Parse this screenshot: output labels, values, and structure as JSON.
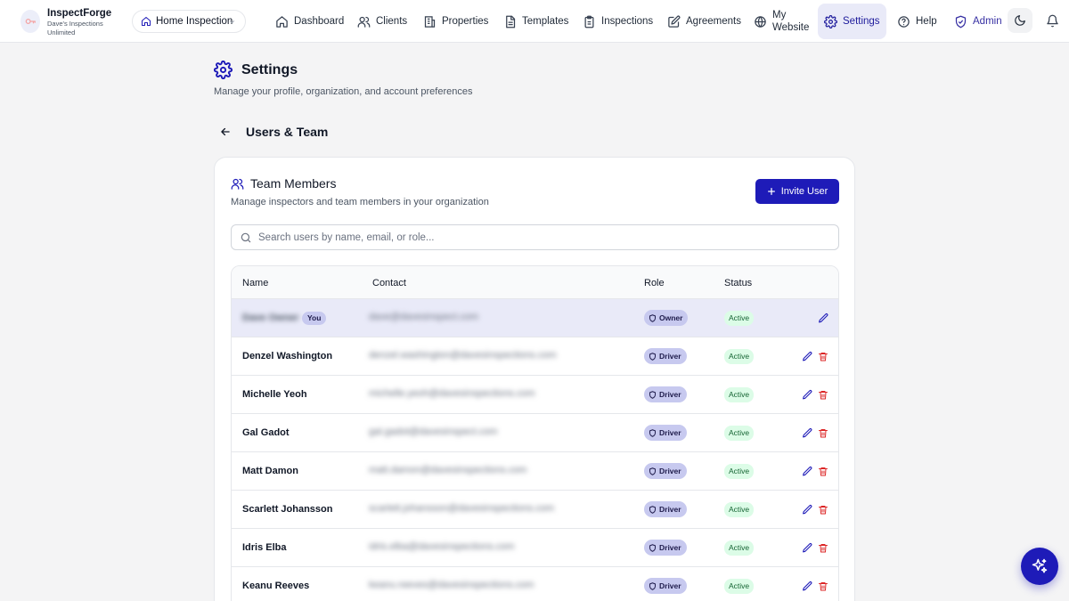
{
  "app": {
    "name": "InspectForge",
    "org": "Dave's Inspections Unlimited",
    "workspace": "Home Inspection"
  },
  "nav": {
    "items": [
      {
        "label": "Dashboard",
        "icon": "home-icon"
      },
      {
        "label": "Clients",
        "icon": "users-icon"
      },
      {
        "label": "Properties",
        "icon": "building-icon"
      },
      {
        "label": "Templates",
        "icon": "file-icon"
      },
      {
        "label": "Inspections",
        "icon": "clipboard-icon"
      },
      {
        "label": "Agreements",
        "icon": "pen-square-icon"
      },
      {
        "label": "My Website",
        "icon": "globe-icon"
      },
      {
        "label": "Settings",
        "icon": "gear-icon",
        "active": true
      },
      {
        "label": "Help",
        "icon": "help-circle-icon"
      },
      {
        "label": "Admin",
        "icon": "shield-check-icon"
      }
    ],
    "my_website_line1": "My",
    "my_website_line2": "Website"
  },
  "page": {
    "title": "Settings",
    "subtitle": "Manage your profile, organization, and account preferences",
    "section": "Users & Team"
  },
  "team": {
    "title": "Team Members",
    "subtitle": "Manage inspectors and team members in your organization",
    "invite_label": "Invite User",
    "search_placeholder": "Search users by name, email, or role...",
    "columns": {
      "name": "Name",
      "contact": "Contact",
      "role": "Role",
      "status": "Status"
    },
    "you_label": "You",
    "members": [
      {
        "name": "Dave Owner",
        "contact": "dave@davesinspect.com",
        "role": "Owner",
        "status": "Active",
        "is_you": true
      },
      {
        "name": "Denzel Washington",
        "contact": "denzel.washington@davesinspections.com",
        "role": "Driver",
        "status": "Active"
      },
      {
        "name": "Michelle Yeoh",
        "contact": "michelle.yeoh@davesinspections.com",
        "role": "Driver",
        "status": "Active"
      },
      {
        "name": "Gal Gadot",
        "contact": "gal.gadot@davesinspect.com",
        "role": "Driver",
        "status": "Active"
      },
      {
        "name": "Matt Damon",
        "contact": "matt.damon@davesinspections.com",
        "role": "Driver",
        "status": "Active"
      },
      {
        "name": "Scarlett Johansson",
        "contact": "scarlett.johansson@davesinspections.com",
        "role": "Driver",
        "status": "Active"
      },
      {
        "name": "Idris Elba",
        "contact": "idris.elba@davesinspections.com",
        "role": "Driver",
        "status": "Active"
      },
      {
        "name": "Keanu Reeves",
        "contact": "keanu.reeves@davesinspections.com",
        "role": "Driver",
        "status": "Active"
      }
    ]
  },
  "colors": {
    "accent": "#1e1bb8",
    "active_nav_bg": "#e9eaf8",
    "role_badge_bg": "#c7c9ef",
    "status_active_bg": "#dcfce7",
    "delete": "#dc2626"
  }
}
